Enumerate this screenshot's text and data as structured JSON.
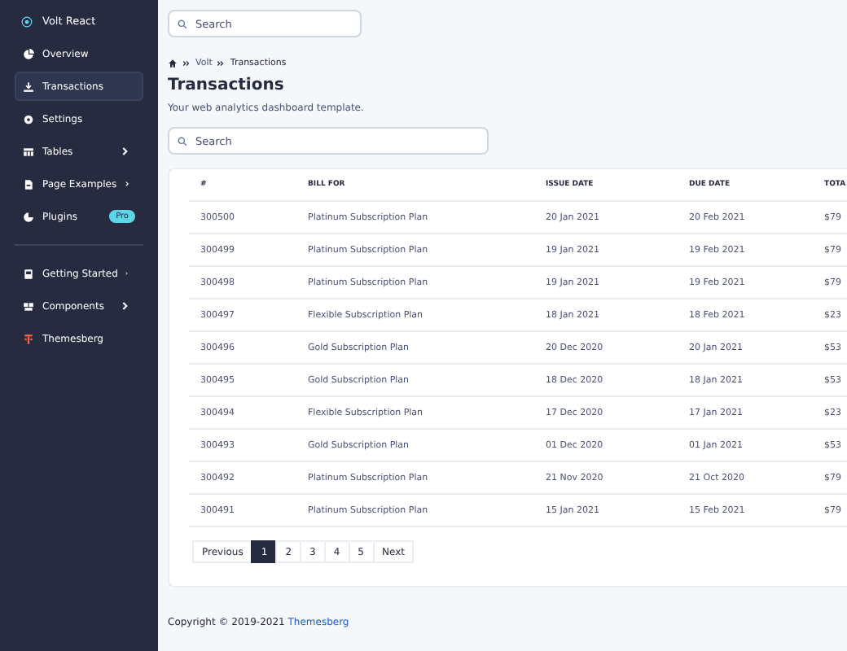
{
  "sidebar": {
    "brand": "Volt React",
    "items": [
      {
        "label": "Overview",
        "selected": false
      },
      {
        "label": "Transactions",
        "selected": true
      },
      {
        "label": "Settings",
        "selected": false
      },
      {
        "label": "Tables",
        "selected": false,
        "expandable": true
      },
      {
        "label": "Page Examples",
        "selected": false,
        "expandable": true
      },
      {
        "label": "Plugins",
        "selected": false,
        "badge": "Pro"
      }
    ],
    "items_2": [
      {
        "label": "Getting Started",
        "selected": false,
        "expandable": true
      },
      {
        "label": "Components",
        "selected": false,
        "expandable": true
      },
      {
        "label": "Themesberg",
        "selected": false
      }
    ]
  },
  "top_search": {
    "placeholder": "Search"
  },
  "breadcrumb": [
    "Volt",
    "Transactions"
  ],
  "page_title": "Transactions",
  "subtitle": "Your web analytics dashboard template.",
  "table_search": {
    "placeholder": "Search"
  },
  "table": {
    "columns": [
      "#",
      "BILL FOR",
      "ISSUE DATE",
      "DUE DATE",
      "TOTA"
    ],
    "rows": [
      [
        "300500",
        "Platinum Subscription Plan",
        "20 Jan 2021",
        "20 Feb 2021",
        "$79"
      ],
      [
        "300499",
        "Platinum Subscription Plan",
        "19 Jan 2021",
        "19 Feb 2021",
        "$79"
      ],
      [
        "300498",
        "Platinum Subscription Plan",
        "19 Jan 2021",
        "19 Feb 2021",
        "$79"
      ],
      [
        "300497",
        "Flexible Subscription Plan",
        "18 Jan 2021",
        "18 Feb 2021",
        "$23"
      ],
      [
        "300496",
        "Gold Subscription Plan",
        "20 Dec 2020",
        "20 Jan 2021",
        "$53"
      ],
      [
        "300495",
        "Gold Subscription Plan",
        "18 Dec 2020",
        "18 Jan 2021",
        "$53"
      ],
      [
        "300494",
        "Flexible Subscription Plan",
        "17 Dec 2020",
        "17 Jan 2021",
        "$23"
      ],
      [
        "300493",
        "Gold Subscription Plan",
        "01 Dec 2020",
        "01 Jan 2021",
        "$53"
      ],
      [
        "300492",
        "Platinum Subscription Plan",
        "21 Nov 2020",
        "21 Oct 2020",
        "$79"
      ],
      [
        "300491",
        "Platinum Subscription Plan",
        "15 Jan 2021",
        "15 Feb 2021",
        "$79"
      ]
    ]
  },
  "pagination": [
    {
      "label": "Previous",
      "selected": false
    },
    {
      "label": "1",
      "selected": true
    },
    {
      "label": "2",
      "selected": false
    },
    {
      "label": "3",
      "selected": false
    },
    {
      "label": "4",
      "selected": false
    },
    {
      "label": "5",
      "selected": false
    },
    {
      "label": "Next",
      "selected": false
    }
  ],
  "footer": {
    "text": "Copyright © 2019-2021",
    "link": "Themesberg"
  }
}
